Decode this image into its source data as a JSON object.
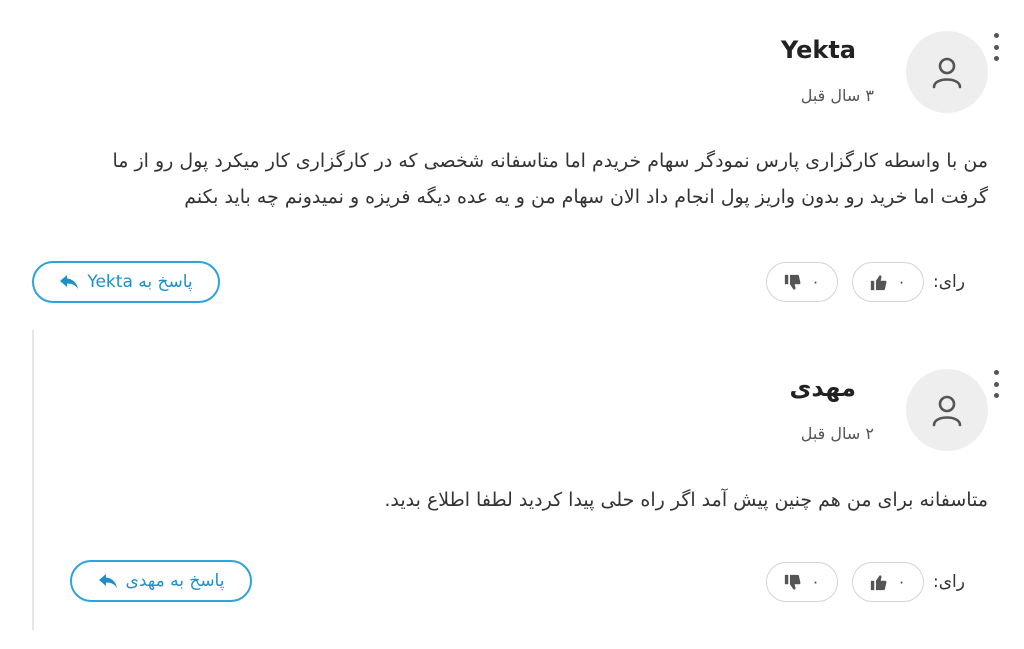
{
  "comments": [
    {
      "author": "Yekta",
      "time": "۳ سال قبل",
      "body_line1": "من با واسطه کارگزاری پارس نمودگر سهام خریدم اما متاسفانه شخصی که در کارگزاری کار میکرد پول رو از ما",
      "body_line2": "گرفت اما خرید رو بدون واریز پول انجام داد الان سهام من و یه عده دیگه فریزه و نمیدونم چه باید بکنم",
      "vote_label": "رای:",
      "likes": "۰",
      "dislikes": "۰",
      "reply_label": "پاسخ به Yekta"
    },
    {
      "author": "مهدی",
      "time": "۲ سال قبل",
      "body_line1": "متاسفانه برای من هم چنین پیش آمد اگر راه حلی پیدا کردید لطفا اطلاع بدید.",
      "vote_label": "رای:",
      "likes": "۰",
      "dislikes": "۰",
      "reply_label": "پاسخ به مهدی"
    }
  ],
  "icons": {
    "avatar": "user-icon",
    "menu": "kebab-menu-icon",
    "like": "thumbs-up-icon",
    "dislike": "thumbs-down-icon",
    "reply": "reply-arrow-icon"
  },
  "colors": {
    "accent": "#2ea2d9",
    "avatar_bg": "#eeeeee",
    "text": "#333333",
    "border": "#d4d4d4",
    "rail": "#e6e6e6"
  }
}
